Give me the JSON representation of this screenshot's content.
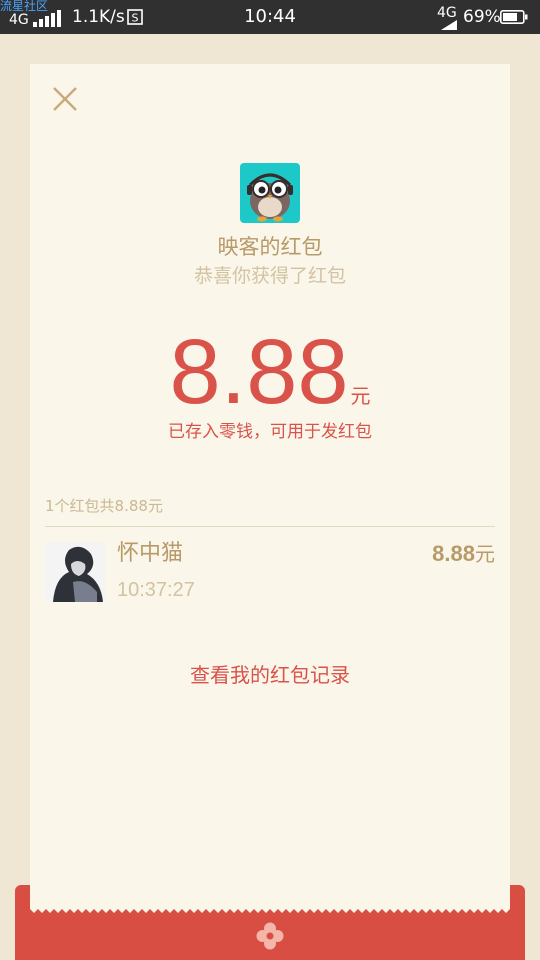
{
  "status_bar": {
    "carrier_label": "流星社区",
    "network_left": "4G",
    "speed": "1.1K/s",
    "time": "10:44",
    "network_right": "4G",
    "battery": "69%"
  },
  "card": {
    "app_name": "映客的红包",
    "subtitle": "恭喜你获得了红包",
    "amount": "8.88",
    "amount_unit": "元",
    "saved_note": "已存入零钱，可用于发红包",
    "summary": "1个红包共8.88元",
    "receiver": {
      "name": "怀中猫",
      "time": "10:37:27",
      "amount": "8.88",
      "amount_unit": "元"
    },
    "records_link": "查看我的红包记录"
  },
  "colors": {
    "accent_red": "#d9534a",
    "gold_text": "#b89a69",
    "card_bg": "#faf6ea",
    "page_bg": "#efe6d3",
    "app_icon_bg": "#1cc8c8"
  },
  "icons": {
    "close": "close-icon",
    "app": "owl-app-icon",
    "envelope_flower": "flower-icon"
  }
}
